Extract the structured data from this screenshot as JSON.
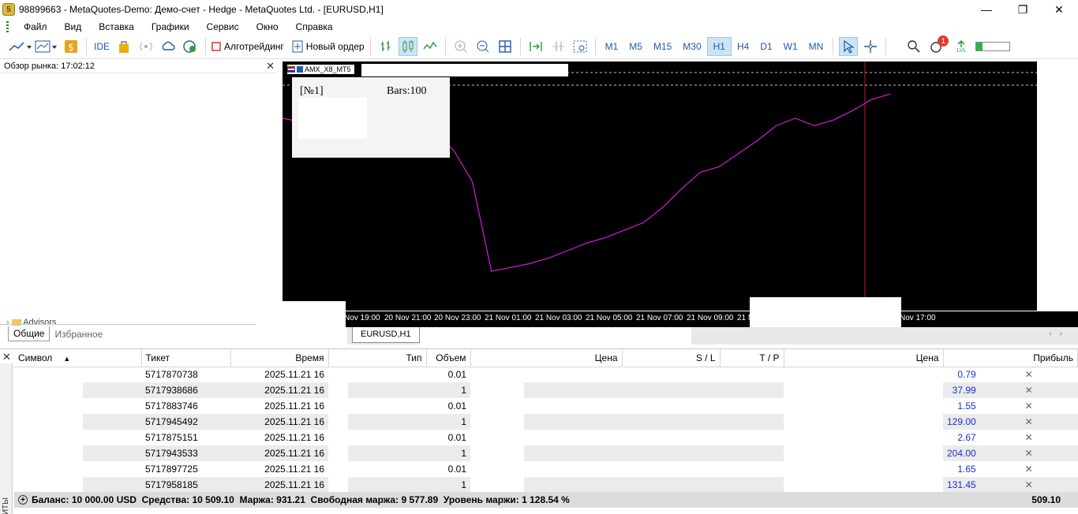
{
  "window": {
    "title": "98899663 - MetaQuotes-Demo: Демо-счет - Hedge - MetaQuotes Ltd. - [EURUSD,H1]",
    "minimize": "—",
    "restore": "❐",
    "close": "✕"
  },
  "menu": [
    "Файл",
    "Вид",
    "Вставка",
    "Графики",
    "Сервис",
    "Окно",
    "Справка"
  ],
  "toolbar": {
    "ide_label": "IDE",
    "algotrading_label": "Алготрейдинг",
    "new_order_label": "Новый ордер",
    "timeframes": [
      "M1",
      "M5",
      "M15",
      "M30",
      "H1",
      "H4",
      "D1",
      "W1",
      "MN"
    ],
    "active_timeframe": "H1",
    "notification_count": "1",
    "lvl_label": "LVL"
  },
  "market_watch": {
    "header": "Обзор рынка: 17:02:12",
    "advisors_label": "Advisors",
    "tabs": [
      "Общие",
      "Избранное"
    ]
  },
  "chart": {
    "ea_name": "AMX_X8_MT5",
    "info_num": "[№1]",
    "info_bars": "Bars:100",
    "time_labels": [
      "Nov 19:00",
      "20 Nov 21:00",
      "20 Nov 23:00",
      "21 Nov 01:00",
      "21 Nov 03:00",
      "21 Nov 05:00",
      "21 Nov 07:00",
      "21 Nov 09:00",
      "21 N",
      "Nov 17:00"
    ],
    "tab_label": "EURUSD,H1",
    "line_color": "#d21fd2",
    "vline_color": "#c21a1a"
  },
  "chart_data": {
    "type": "line",
    "series": [
      {
        "values": [
          318,
          316,
          316,
          317,
          320,
          309,
          318,
          313,
          311,
          301,
          284,
          236,
          238,
          240,
          243,
          247,
          251,
          254,
          258,
          262,
          270,
          280,
          289,
          292,
          299,
          306,
          314,
          318,
          314,
          317,
          322,
          328,
          331
        ]
      }
    ]
  },
  "positions": {
    "columns": [
      "Символ",
      "Тикет",
      "Время",
      "Тип",
      "Объем",
      "Цена",
      "S / L",
      "T / P",
      "Цена",
      "Прибыль"
    ],
    "rows": [
      {
        "ticket": "5717870738",
        "time": "2025.11.21 16",
        "volume": "0.01",
        "profit": "0.79"
      },
      {
        "ticket": "5717938686",
        "time": "2025.11.21 16",
        "volume": "1",
        "profit": "37.99"
      },
      {
        "ticket": "5717883746",
        "time": "2025.11.21 16",
        "volume": "0.01",
        "profit": "1.55"
      },
      {
        "ticket": "5717945492",
        "time": "2025.11.21 16",
        "volume": "1",
        "profit": "129.00"
      },
      {
        "ticket": "5717875151",
        "time": "2025.11.21 16",
        "volume": "0.01",
        "profit": "2.67"
      },
      {
        "ticket": "5717943533",
        "time": "2025.11.21 16",
        "volume": "1",
        "profit": "204.00"
      },
      {
        "ticket": "5717897725",
        "time": "2025.11.21 16",
        "volume": "0.01",
        "profit": "1.65"
      },
      {
        "ticket": "5717958185",
        "time": "2025.11.21 16",
        "volume": "1",
        "profit": "131.45"
      }
    ],
    "row_close": "✕",
    "side_label": "ИТЫ"
  },
  "status": {
    "summary": "Баланс: 10 000.00 USD  Средства: 10 509.10  Маржа: 931.21  Свободная маржа: 9 577.89  Уровень маржи: 1 128.54 %",
    "total_profit": "509.10"
  }
}
